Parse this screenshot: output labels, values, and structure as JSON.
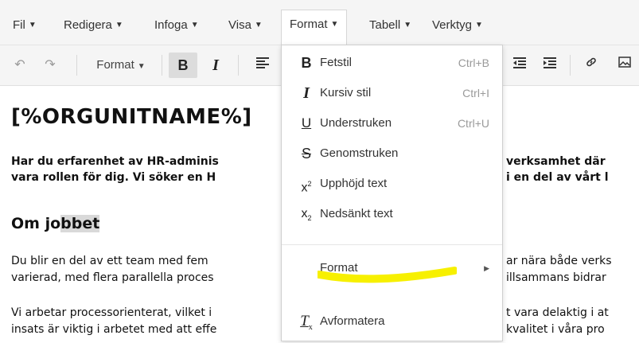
{
  "menubar": {
    "items": [
      {
        "label": "Fil"
      },
      {
        "label": "Redigera"
      },
      {
        "label": "Infoga"
      },
      {
        "label": "Visa"
      },
      {
        "label": "Format"
      },
      {
        "label": "Tabell"
      },
      {
        "label": "Verktyg"
      }
    ],
    "active_index": 4
  },
  "toolbar": {
    "format_label": "Format",
    "bold_glyph": "B",
    "italic_glyph": "I"
  },
  "document": {
    "title": "[%ORGUNITNAME%]",
    "intro_line1_left": "Har du erfarenhet av HR-adminis",
    "intro_line1_right": "verksamhet där",
    "intro_line2_left": "vara rollen för dig. Vi söker en H",
    "intro_line2_right": "i en del av vårt l",
    "subheading_plain": "Om jo",
    "subheading_highlight": "bbet",
    "p1_line1_left": "Du blir en del av ett team med fem",
    "p1_line1_right": "ar nära både verks",
    "p1_line2_left": "varierad, med flera parallella proces",
    "p1_line2_right": "illsammans bidrar",
    "p2_line1_left": "Vi arbetar processorienterat, vilket i",
    "p2_line1_right": "t vara delaktig i at",
    "p2_line2_left": "insats är viktig i arbetet med att effe",
    "p2_line2_right": "kvalitet i våra pro"
  },
  "format_menu": {
    "items": [
      {
        "icon": "bold-icon",
        "label": "Fetstil",
        "shortcut": "Ctrl+B"
      },
      {
        "icon": "italic-icon",
        "label": "Kursiv stil",
        "shortcut": "Ctrl+I"
      },
      {
        "icon": "underline-icon",
        "label": "Understruken",
        "shortcut": "Ctrl+U"
      },
      {
        "icon": "strikethrough-icon",
        "label": "Genomstruken",
        "shortcut": ""
      },
      {
        "icon": "superscript-icon",
        "label": "Upphöjd text",
        "shortcut": ""
      },
      {
        "icon": "subscript-icon",
        "label": "Nedsänkt text",
        "shortcut": ""
      }
    ],
    "format_submenu_label": "Format",
    "clear_label": "Avformatera"
  },
  "colors": {
    "highlight_marker": "#f7f000",
    "menubar_bg": "#f5f5f5"
  }
}
